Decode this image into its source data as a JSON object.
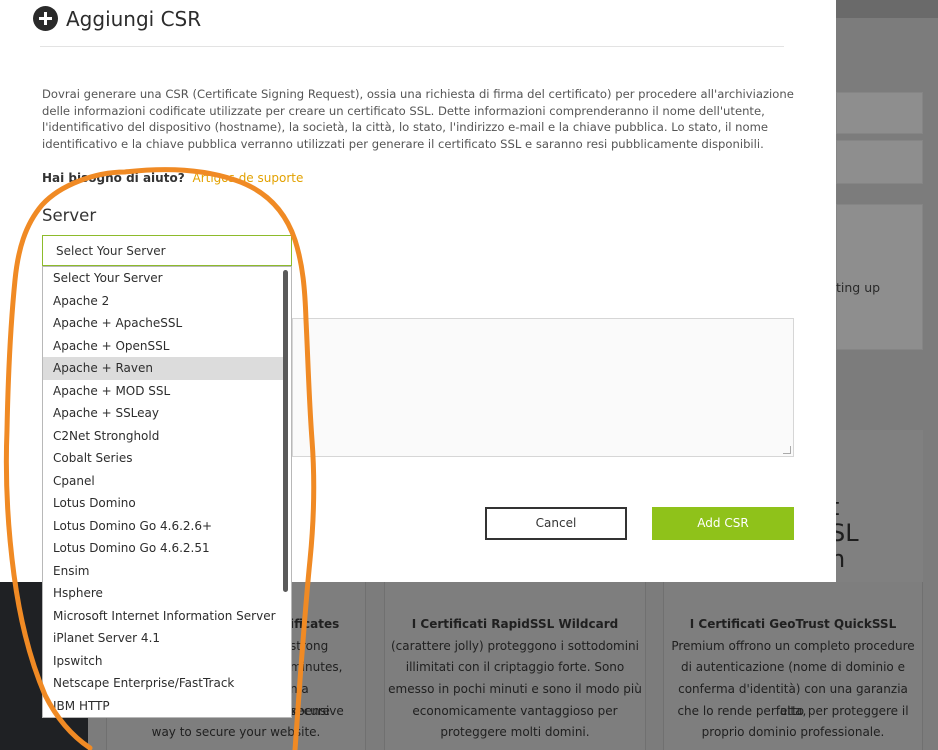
{
  "modal": {
    "title": "Aggiungi CSR",
    "description": "Dovrai generare una CSR (Certificate Signing Request), ossia una richiesta di firma del certificato) per procedere all'archiviazione delle informazioni codificate utilizzate per creare un certificato SSL. Dette informazioni comprenderanno il nome dell'utente, l'identificativo del dispositivo (hostname), la società, la città, lo stato, l'indirizzo e-mail e la chiave pubblica. Lo stato, il nome identificativo e la chiave pubblica verranno utilizzati per generare il certificato SSL e saranno resi pubblicamente disponibili.",
    "help_label": "Hai bisogno di aiuto?",
    "help_link": "Artigos de suporte",
    "server_label": "Server",
    "select_value": "Select Your Server",
    "cancel_label": "Cancel",
    "add_label": "Add CSR"
  },
  "dropdown": {
    "options": [
      "Select Your Server",
      "Apache 2",
      "Apache + ApacheSSL",
      "Apache + OpenSSL",
      "Apache + Raven",
      "Apache + MOD SSL",
      "Apache + SSLeay",
      "C2Net Stronghold",
      "Cobalt Series",
      "Cpanel",
      "Lotus Domino",
      "Lotus Domino Go 4.6.2.6+",
      "Lotus Domino Go 4.6.2.51",
      "Ensim",
      "Hsphere",
      "Microsoft Internet Information Server",
      "iPlanet Server 4.1",
      "Ipswitch",
      "Netscape Enterprise/FastTrack",
      "IBM HTTP"
    ],
    "highlighted_index": 4
  },
  "background": {
    "right_snippet": "ting up",
    "big_right_lines": [
      "t",
      "SL",
      "n"
    ],
    "card1_lines": [
      "ificates",
      "strong",
      "minutes,",
      "n a secure",
      "xpensive",
      "way to secure your website."
    ],
    "card2_title": "I Certificati RapidSSL Wildcard",
    "card2_lines": [
      "(carattere jolly) proteggono i sottodomini",
      "illimitati con il criptaggio forte. Sono",
      "emesso in pochi minuti e sono il modo più",
      "economicamente vantaggioso per",
      "proteggere molti domini."
    ],
    "card3_title": "I Certificati GeoTrust QuickSSL",
    "card3_lines": [
      "Premium offrono un completo procedure",
      "di autenticazione (nome di dominio e",
      "conferma d'identità) con una garanzia alta,",
      "che lo rende perfetto per proteggere il",
      "proprio dominio professionale."
    ]
  },
  "colors": {
    "accent_green": "#8fc21a",
    "link_orange": "#e2a100",
    "annotation_orange": "#f08a24"
  }
}
